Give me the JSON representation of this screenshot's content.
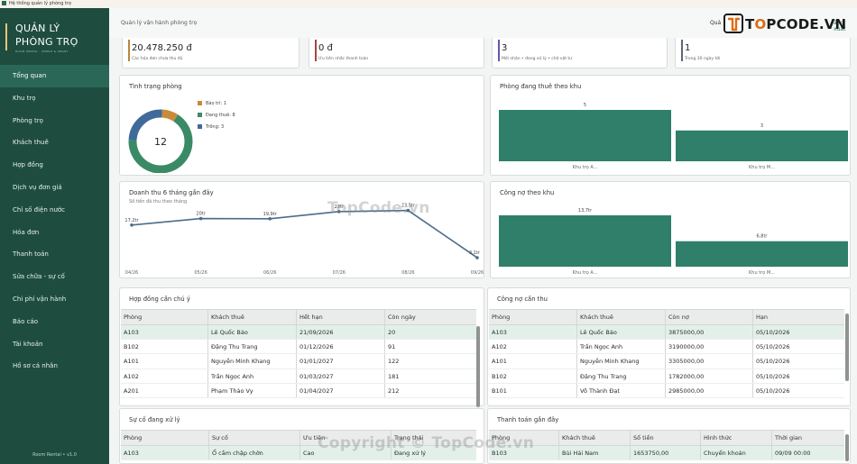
{
  "window": {
    "title": "Hệ thống quản lý phòng trọ"
  },
  "sidebar": {
    "logo_line1": "QUẢN LÝ",
    "logo_line2": "PHÒNG TRỌ",
    "logo_tagline": "ROOM RENTAL · SIMPLE & SMART",
    "items": [
      {
        "label": "Tổng quan",
        "active": true
      },
      {
        "label": "Khu trọ"
      },
      {
        "label": "Phòng trọ"
      },
      {
        "label": "Khách thuê"
      },
      {
        "label": "Hợp đồng"
      },
      {
        "label": "Dịch vụ  đơn giá"
      },
      {
        "label": "Chỉ số điện nước"
      },
      {
        "label": "Hóa đơn"
      },
      {
        "label": "Thanh toán"
      },
      {
        "label": "Sửa chữa - sự cố"
      },
      {
        "label": "Chi phí vận hành"
      },
      {
        "label": "Báo cáo"
      },
      {
        "label": "Tài khoản"
      },
      {
        "label": "Hồ sơ cá nhân"
      }
    ],
    "version": "Room Rental • v1.0"
  },
  "header": {
    "breadcrumb": "Quản lý vận hành phòng trọ",
    "right_text": "Quả",
    "brand_text_1": "T",
    "brand_text_2": "O",
    "brand_text_3": "PCODE.VN",
    "logout_label": "ăng xuất"
  },
  "stats": [
    {
      "value": "20.478.250 đ",
      "sub": "Các hóa đơn chưa thu đủ",
      "color": "#b8863a"
    },
    {
      "value": "0 đ",
      "sub": "Ưu tiên nhắc thanh toán",
      "color": "#a8443d"
    },
    {
      "value": "3",
      "sub": "Mới nhận • đang xử lý • chờ vật tư",
      "color": "#6a55a8"
    },
    {
      "value": "1",
      "sub": "Trong 30 ngày tới",
      "color": "#5a6a7a"
    }
  ],
  "room_status": {
    "title": "Tình trạng phòng",
    "total": "12",
    "legend": [
      {
        "label": "Bảo trì: 1",
        "value": 1,
        "color": "#c98a3a"
      },
      {
        "label": "Đang thuê: 8",
        "value": 8,
        "color": "#3a8a66"
      },
      {
        "label": "Trống: 3",
        "value": 3,
        "color": "#3f6a9a"
      }
    ]
  },
  "occupied_by_area": {
    "title": "Phòng đang thuê theo khu",
    "chart_data": {
      "type": "bar",
      "categories": [
        "Khu trọ A...",
        "Khu trọ M..."
      ],
      "values": [
        5,
        3
      ],
      "value_labels": [
        "5",
        "3"
      ],
      "color": "#2f7f6b"
    }
  },
  "revenue": {
    "title": "Doanh thu 6 tháng gần đây",
    "subtitle": "Số tiền đã thu theo tháng",
    "chart_data": {
      "type": "line",
      "categories": [
        "04/26",
        "05/26",
        "06/26",
        "07/26",
        "08/26",
        "09/26"
      ],
      "values": [
        17.2,
        20,
        19.9,
        23,
        23.5,
        3.1
      ],
      "value_labels": [
        "17,2tr",
        "20tr",
        "19,9tr",
        "23tr",
        "23,5tr",
        "3,1tr"
      ],
      "ylim": [
        0,
        28
      ],
      "color": "#4a6c8a"
    }
  },
  "debt_by_area": {
    "title": "Công nợ theo khu",
    "chart_data": {
      "type": "bar",
      "categories": [
        "Khu trọ A...",
        "Khu trọ M..."
      ],
      "values": [
        13.7,
        6.8
      ],
      "value_labels": [
        "13,7tr",
        "6,8tr"
      ],
      "color": "#2f7f6b"
    }
  },
  "contracts": {
    "title": "Hợp đồng cần chú ý",
    "columns": [
      "Phòng",
      "Khách thuê",
      "Hết hạn",
      "Còn ngày"
    ],
    "rows": [
      [
        "A103",
        "Lê Quốc Bảo",
        "21/09/2026",
        "20"
      ],
      [
        "B102",
        "Đặng Thu Trang",
        "01/12/2026",
        "91"
      ],
      [
        "A101",
        "Nguyễn Minh Khang",
        "01/01/2027",
        "122"
      ],
      [
        "A102",
        "Trần Ngọc Anh",
        "01/03/2027",
        "181"
      ],
      [
        "A201",
        "Phạm Thảo Vy",
        "01/04/2027",
        "212"
      ]
    ]
  },
  "debts": {
    "title": "Công nợ cần thu",
    "columns": [
      "Phòng",
      "Khách thuê",
      "Còn nợ",
      "Hạn"
    ],
    "rows": [
      [
        "A103",
        "Lê Quốc Bảo",
        "3875000,00",
        "05/10/2026"
      ],
      [
        "A102",
        "Trần Ngọc Anh",
        "3190000,00",
        "05/10/2026"
      ],
      [
        "A101",
        "Nguyễn Minh Khang",
        "3305000,00",
        "05/10/2026"
      ],
      [
        "B102",
        "Đặng Thu Trang",
        "1782000,00",
        "05/10/2026"
      ],
      [
        "B101",
        "Võ Thành Đạt",
        "2985000,00",
        "05/10/2026"
      ]
    ]
  },
  "incidents": {
    "title": "Sự cố đang xử lý",
    "columns": [
      "Phòng",
      "Sự cố",
      "Ưu tiên",
      "Trạng thái"
    ],
    "rows": [
      [
        "A103",
        "Ổ cắm chập chờn",
        "Cao",
        "Đang xử lý"
      ]
    ]
  },
  "payments": {
    "title": "Thanh toán gần đây",
    "columns": [
      "Phòng",
      "Khách thuê",
      "Số tiền",
      "Hình thức",
      "Thời gian"
    ],
    "rows": [
      [
        "B103",
        "Bùi Hải Nam",
        "1653750,00",
        "Chuyển khoản",
        "09/09 00:00"
      ]
    ]
  },
  "watermarks": {
    "center": "TopCode.vn",
    "bottom": "Copyright © TopCode.vn"
  }
}
